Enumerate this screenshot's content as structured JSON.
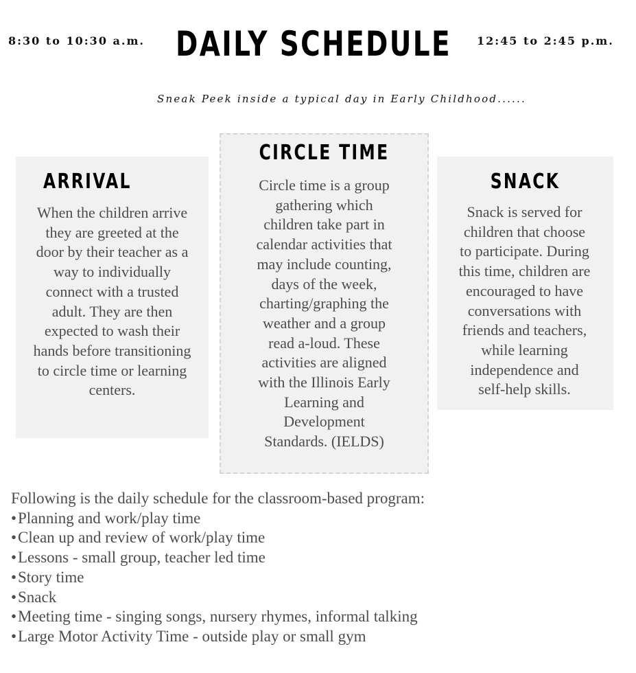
{
  "header": {
    "morning_time": "8:30 to 10:30 a.m.",
    "title": "DAILY SCHEDULE",
    "afternoon_time": "12:45 to 2:45 p.m.",
    "subtitle": "Sneak Peek inside a typical day in Early Childhood......"
  },
  "cards": {
    "arrival": {
      "heading": "ARRIVAL",
      "lines": [
        "When the children arrive",
        "they are greeted at the",
        "door by their teacher as a",
        "way to individually",
        "connect with a trusted",
        "adult. They are then",
        "expected to wash their",
        "hands before transitioning",
        "to circle time or learning",
        "centers."
      ]
    },
    "circle_time": {
      "heading": "CIRCLE TIME",
      "lines": [
        "Circle time is a group",
        "gathering which",
        "children take part in",
        "calendar activities that",
        "may include counting,",
        "days of the week,",
        "charting/graphing the",
        "weather and a group",
        "read a-loud.  These",
        "activities are aligned",
        "with the Illinois Early",
        "Learning and",
        "Development",
        "Standards. (IELDS)"
      ]
    },
    "snack": {
      "heading": "SNACK",
      "lines": [
        "Snack is served for",
        "children that choose",
        "to participate.  During",
        "this time, children are",
        "encouraged to have",
        "conversations with",
        "friends and teachers,",
        "while learning",
        "independence and",
        "self-help skills."
      ]
    }
  },
  "schedule": {
    "intro": "Following is the daily schedule for the classroom-based program:",
    "bullet": "•",
    "items": [
      "Planning and work/play time",
      "Clean up and review of work/play time",
      "Lessons - small group, teacher led time",
      "Story time",
      "Snack",
      "Meeting time - singing songs, nursery rhymes, informal talking",
      "Large Motor Activity Time - outside play or small gym"
    ]
  },
  "colors": {
    "card_background": "#f1f1f1",
    "card_border_dashed": "#d4d4d4",
    "heading": "#000000",
    "body_text": "#4c4c4c"
  }
}
